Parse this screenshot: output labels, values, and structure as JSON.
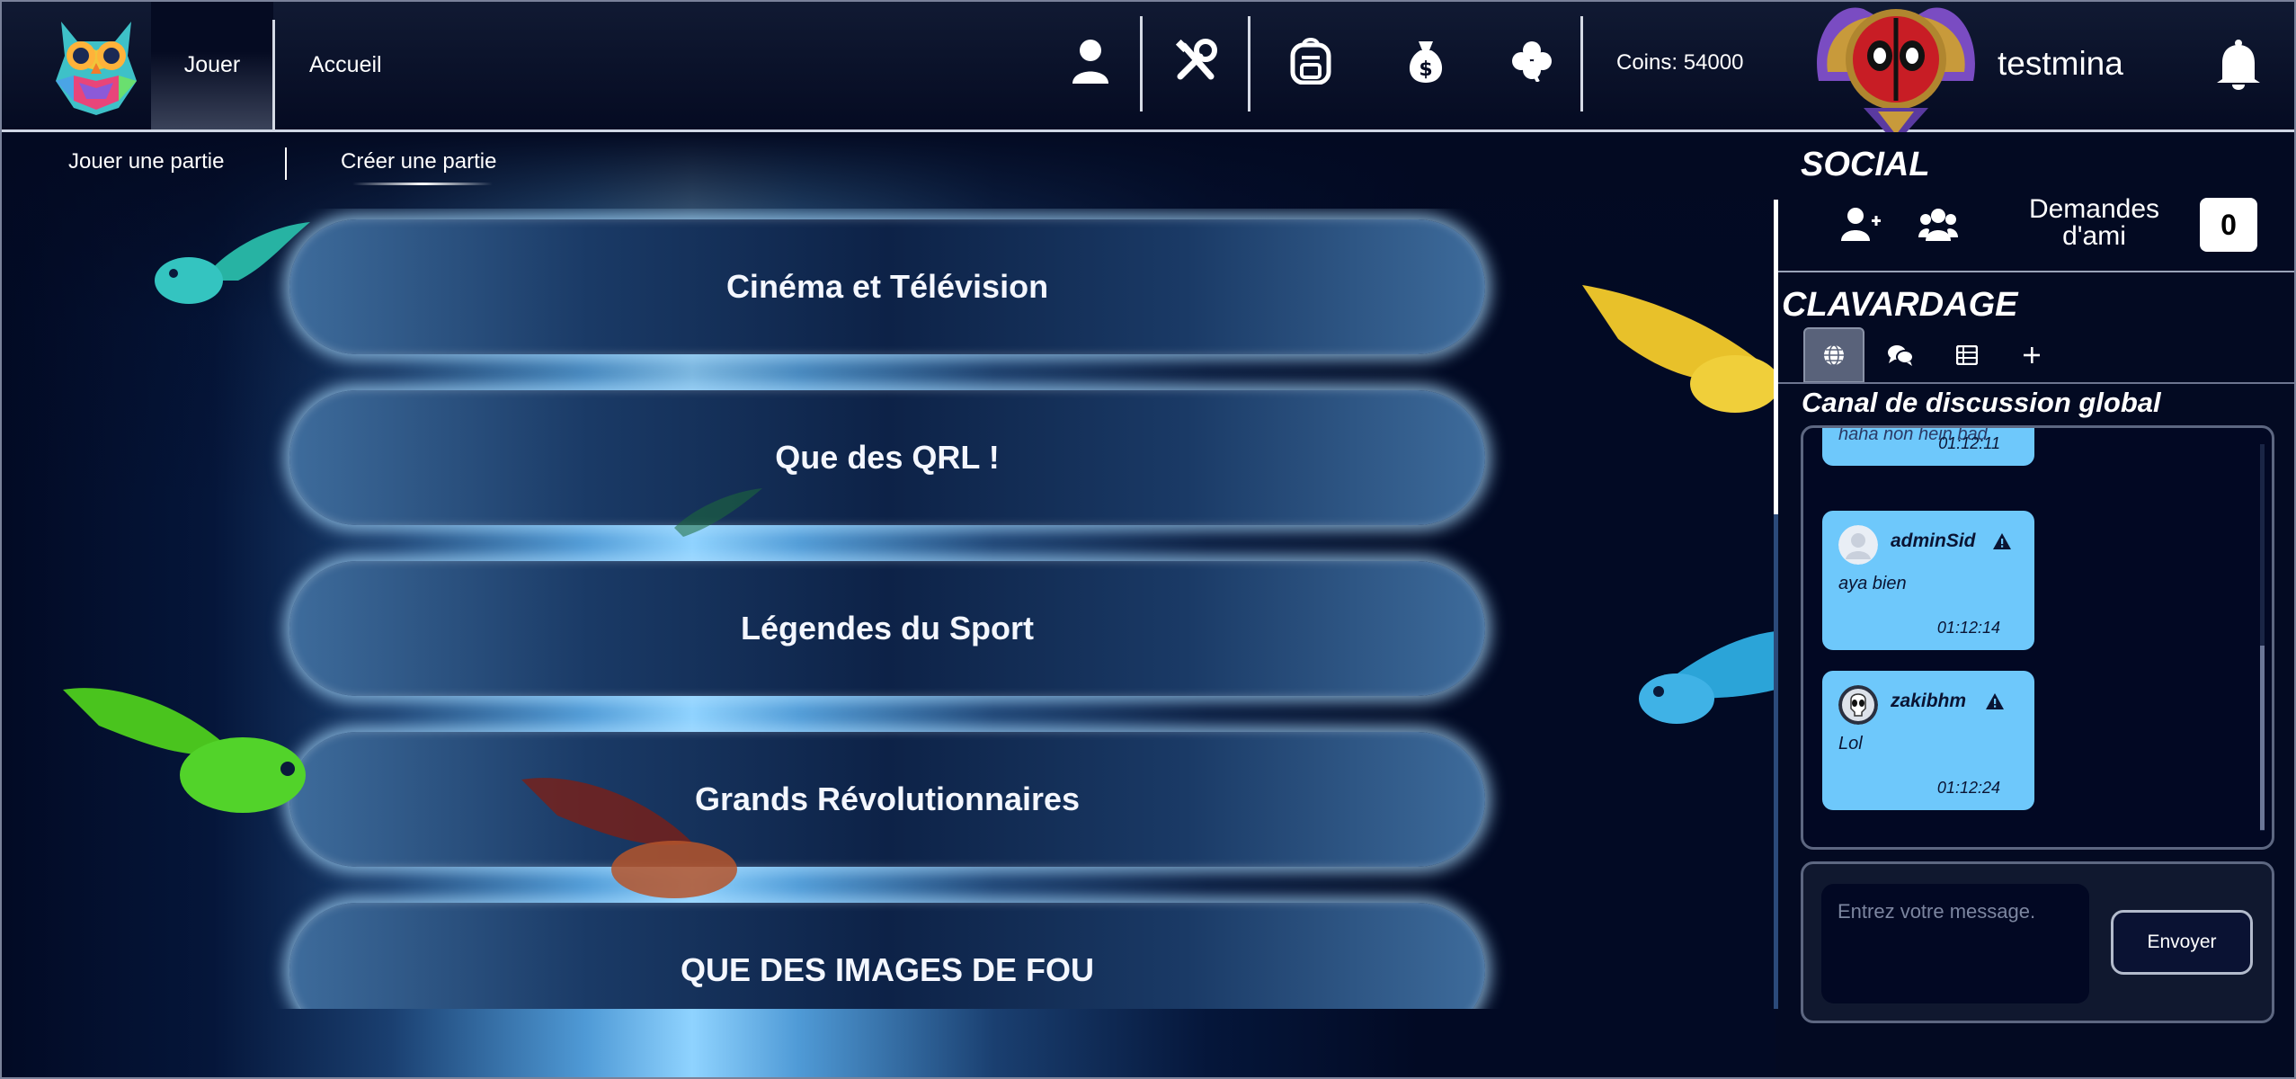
{
  "header": {
    "nav": [
      "Jouer",
      "Accueil"
    ],
    "coins_label": "Coins: 54000",
    "username": "testmina",
    "icons": [
      "profile-icon",
      "tools-icon",
      "backpack-icon",
      "money-bag-icon",
      "clover-icon",
      "bell-icon"
    ]
  },
  "subnav": {
    "items": [
      "Jouer une partie",
      "Créer une partie"
    ]
  },
  "categories": [
    "Cinéma et Télévision",
    "Que des QRL !",
    "Légendes du Sport",
    "Grands Révolutionnaires",
    "QUE DES IMAGES DE FOU"
  ],
  "social": {
    "title": "SOCIAL",
    "requests_label": "Demandes d'ami",
    "requests_count": "0"
  },
  "chat": {
    "title": "CLAVARDAGE",
    "channel_title": "Canal de discussion global",
    "tabs": [
      "globe-icon",
      "chat-bubbles-icon",
      "list-icon",
      "plus-icon"
    ],
    "messages": [
      {
        "user": "",
        "text": "haha non hein bad",
        "time": "01:12:11"
      },
      {
        "user": "adminSid",
        "text": "aya bien",
        "time": "01:12:14"
      },
      {
        "user": "zakibhm",
        "text": "Lol",
        "time": "01:12:24"
      }
    ],
    "input_placeholder": "Entrez votre message.",
    "send_label": "Envoyer"
  },
  "colors": {
    "accent": "#6ec8fb",
    "background": "#030a22",
    "category_glow": "#aadcff"
  }
}
